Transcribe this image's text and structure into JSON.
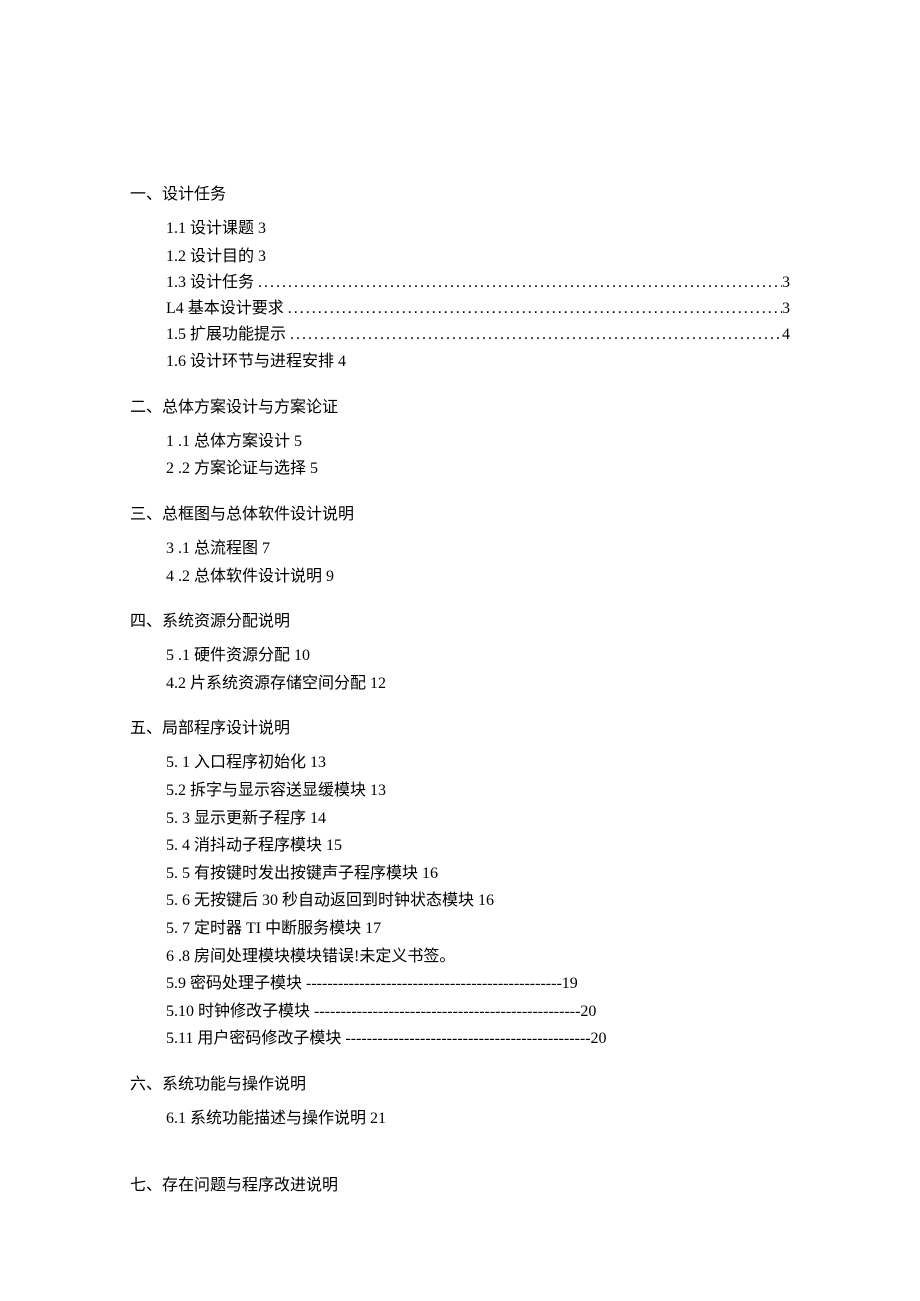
{
  "sections": [
    {
      "heading": "一、设计任务",
      "items": [
        {
          "label": "1.1   设计课题 3",
          "dotted": false
        },
        {
          "label": "1.2   设计目的 3",
          "dotted": false
        },
        {
          "label": "1.3   设计任务",
          "dotted": true,
          "page": "3"
        },
        {
          "label": "L4 基本设计要求",
          "dotted": true,
          "page": "3"
        },
        {
          "label": "1.5   扩展功能提示",
          "dotted": true,
          "page": "4"
        },
        {
          "label": "1.6   设计环节与进程安排 4",
          "dotted": false
        }
      ]
    },
    {
      "heading": "二、总体方案设计与方案论证",
      "items": [
        {
          "label": "1   .1 总体方案设计 5",
          "dotted": false
        },
        {
          "label": "2   .2 方案论证与选择 5",
          "dotted": false
        }
      ]
    },
    {
      "heading": "三、总框图与总体软件设计说明",
      "items": [
        {
          "label": "3   .1 总流程图 7",
          "dotted": false
        },
        {
          "label": "4   .2 总体软件设计说明 9",
          "dotted": false
        }
      ]
    },
    {
      "heading": "四、系统资源分配说明",
      "items": [
        {
          "label": "5   .1 硬件资源分配 10",
          "dotted": false
        },
        {
          "label": "4.2 片系统资源存储空间分配 12",
          "dotted": false
        }
      ]
    },
    {
      "heading": "五、局部程序设计说明",
      "items": [
        {
          "label": "5.  1 入口程序初始化 13",
          "dotted": false
        },
        {
          "label": "5.2 拆字与显示容送显缓模块 13",
          "dotted": false
        },
        {
          "label": "5.  3 显示更新子程序 14",
          "dotted": false
        },
        {
          "label": "5.  4 消抖动子程序模块 15",
          "dotted": false
        },
        {
          "label": "5.  5 有按键时发出按键声子程序模块 16",
          "dotted": false
        },
        {
          "label": "5.  6 无按键后 30 秒自动返回到时钟状态模块 16",
          "dotted": false
        },
        {
          "label": "5.  7 定时器 TI 中断服务模块 17",
          "dotted": false
        },
        {
          "label": "6   .8 房间处理模块模块错误!未定义书签。",
          "dotted": false
        },
        {
          "label": "5.9 密码处理子模块 ",
          "dash": "------------------------------------------------",
          "page": "19",
          "dotted": false
        },
        {
          "label": "5.10 时钟修改子模块 ",
          "dash": "--------------------------------------------------",
          "page": "20",
          "dotted": false
        },
        {
          "label": "5.11 用户密码修改子模块 ",
          "dash": "----------------------------------------------",
          "page": "20",
          "dotted": false
        }
      ]
    },
    {
      "heading": "六、系统功能与操作说明",
      "items": [
        {
          "label": "6.1 系统功能描述与操作说明 21",
          "dotted": false
        }
      ]
    },
    {
      "heading": "七、存在问题与程序改进说明",
      "extraGap": true,
      "items": []
    }
  ]
}
